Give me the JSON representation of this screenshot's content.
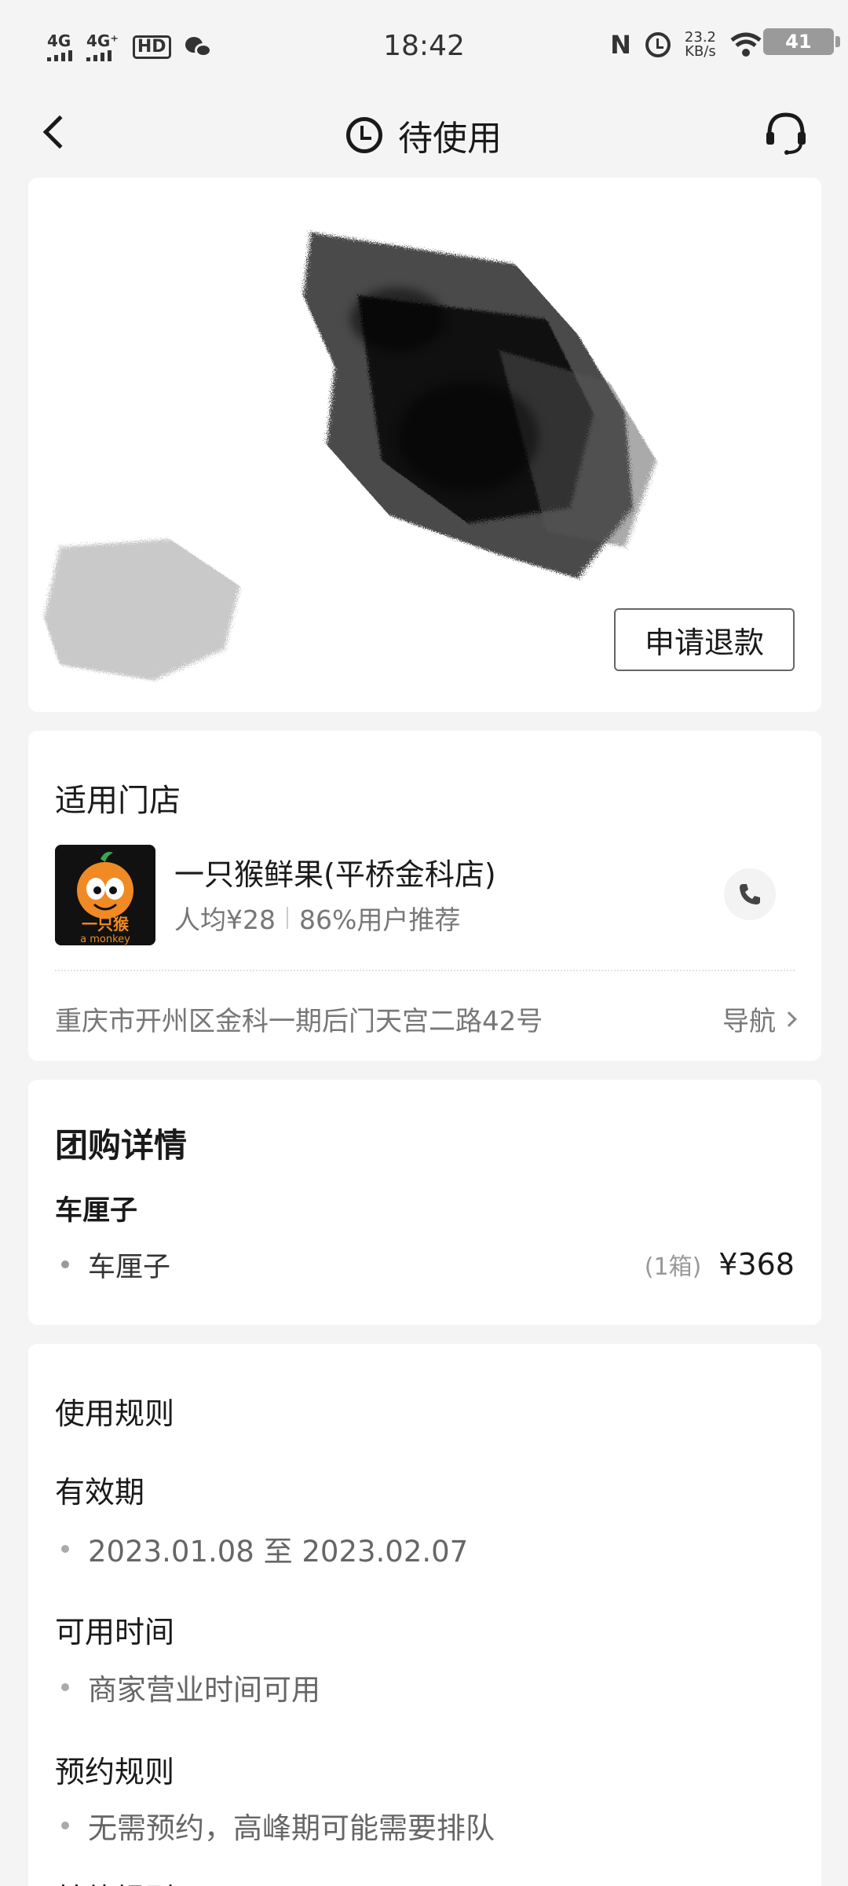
{
  "status_bar": {
    "sig1": "4G",
    "sig2": "4G⁺",
    "hd": "HD",
    "time": "18:42",
    "speed_value": "23.2",
    "speed_unit": "KB/s",
    "battery": "41"
  },
  "header": {
    "title": "待使用"
  },
  "voucher": {
    "refund_label": "申请退款"
  },
  "store": {
    "section_title": "适用门店",
    "name": "一只猴鲜果(平桥金科店)",
    "avg_price": "人均¥28",
    "recommend": "86%用户推荐",
    "address": "重庆市开州区金科一期后门天宫二路42号",
    "nav_label": "导航",
    "logo_text": "一只猴",
    "logo_subtext": "a monkey"
  },
  "group_buy": {
    "title": "团购详情",
    "subtitle": "车厘子",
    "items": [
      {
        "name": "车厘子",
        "qty": "(1箱)",
        "price": "¥368"
      }
    ]
  },
  "rules": {
    "title": "使用规则",
    "validity_label": "有效期",
    "validity_value": "2023.01.08 至 2023.02.07",
    "time_label": "可用时间",
    "time_value": "商家营业时间可用",
    "booking_label": "预约规则",
    "booking_value": "无需预约，高峰期可能需要排队",
    "partial_label": "其他规则"
  }
}
